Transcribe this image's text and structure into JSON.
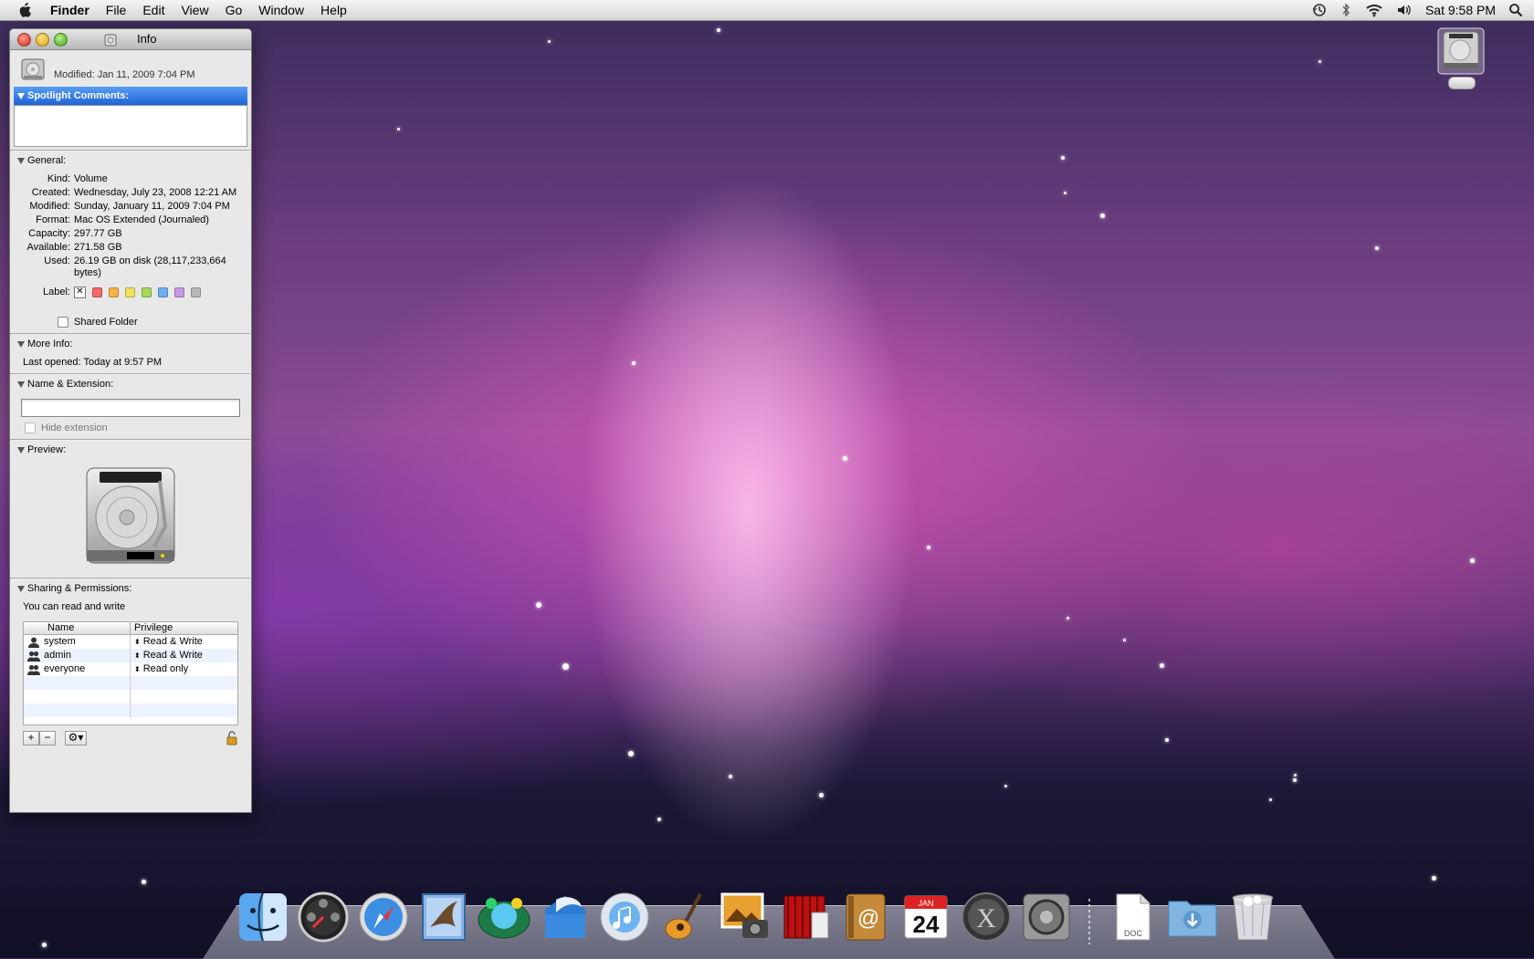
{
  "menubar": {
    "app_name": "Finder",
    "menus": [
      "File",
      "Edit",
      "View",
      "Go",
      "Window",
      "Help"
    ],
    "clock": "Sat 9:58 PM",
    "status_icons": [
      "time-machine-icon",
      "bluetooth-icon",
      "wifi-icon",
      "volume-icon",
      "spotlight-icon"
    ]
  },
  "info_window": {
    "title": "Info",
    "header_modified": "Modified: Jan 11, 2009 7:04 PM",
    "spotlight": {
      "heading": "Spotlight Comments:",
      "value": ""
    },
    "general": {
      "heading": "General:",
      "kind_label": "Kind:",
      "kind": "Volume",
      "created_label": "Created:",
      "created": "Wednesday, July 23, 2008 12:21 AM",
      "modified_label": "Modified:",
      "modified": "Sunday, January 11, 2009 7:04 PM",
      "format_label": "Format:",
      "format": "Mac OS Extended (Journaled)",
      "capacity_label": "Capacity:",
      "capacity": "297.77 GB",
      "available_label": "Available:",
      "available": "271.58 GB",
      "used_label": "Used:",
      "used": "26.19 GB on disk (28,117,233,664 bytes)",
      "label_label": "Label:",
      "label_colors": [
        "#f26b63",
        "#f8b24a",
        "#f3e15b",
        "#a6d85b",
        "#6fb0f2",
        "#c89ae2",
        "#b8b8b8"
      ],
      "shared_folder": "Shared Folder"
    },
    "more_info": {
      "heading": "More Info:",
      "last_opened": "Last opened: Today at 9:57 PM"
    },
    "name_ext": {
      "heading": "Name & Extension:",
      "name_value": "",
      "hide_extension": "Hide extension"
    },
    "preview": {
      "heading": "Preview:"
    },
    "sharing": {
      "heading": "Sharing & Permissions:",
      "summary": "You can read and write",
      "columns": [
        "Name",
        "Privilege"
      ],
      "rows": [
        {
          "name": "system",
          "privilege": "Read & Write",
          "icon": "user-icon"
        },
        {
          "name": "admin",
          "privilege": "Read & Write",
          "icon": "group-icon"
        },
        {
          "name": "everyone",
          "privilege": "Read only",
          "icon": "group-icon"
        }
      ]
    }
  },
  "dock": {
    "items": [
      "finder-icon",
      "dashboard-icon",
      "safari-icon",
      "mail-icon",
      "photo-booth-icon",
      "openoffice-icon",
      "itunes-icon",
      "garageband-icon",
      "iphoto-icon",
      "front-row-icon",
      "address-book-icon",
      "ical-icon",
      "system-x-icon",
      "system-preferences-icon"
    ],
    "ical_month": "JAN",
    "ical_day": "24",
    "doc_label": "DOC"
  }
}
